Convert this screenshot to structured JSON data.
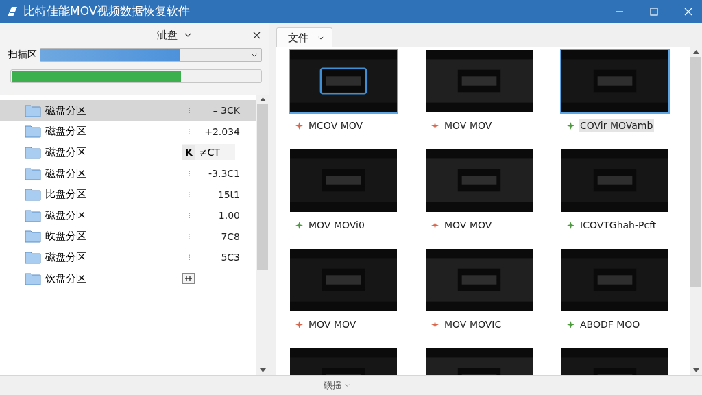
{
  "window": {
    "title": "比特佳能MOV视频数据恢复软件"
  },
  "left_panel": {
    "header": "泚盘",
    "scan": {
      "label": "扫描区",
      "level": 0.63
    },
    "progress": {
      "level": 0.68
    },
    "items": [
      {
        "name": "磁盘分区",
        "marker": "⁝",
        "value": "–  3CK",
        "selected": true,
        "kind": "dots"
      },
      {
        "name": "磁盘分区",
        "marker": "⁝",
        "value": "+2.034",
        "selected": false,
        "kind": "dots"
      },
      {
        "name": "磁盘分区",
        "marker": "K",
        "value": "≠CT",
        "selected": false,
        "kind": "key"
      },
      {
        "name": "磁盘分区",
        "marker": "⁝",
        "value": "-3.3C1",
        "selected": false,
        "kind": "dots"
      },
      {
        "name": "比盘分区",
        "marker": "⁝",
        "value": "15t1",
        "selected": false,
        "kind": "dots"
      },
      {
        "name": "磁盘分区",
        "marker": "⁝",
        "value": "1.00",
        "selected": false,
        "kind": "dots"
      },
      {
        "name": "敀盘分区",
        "marker": "⁝",
        "value": "7C8",
        "selected": false,
        "kind": "dots"
      },
      {
        "name": "磁盘分区",
        "marker": "⁝",
        "value": "5C3",
        "selected": false,
        "kind": "dots"
      },
      {
        "name": "饮盘分区",
        "kind": "box",
        "selected": false
      }
    ]
  },
  "right_panel": {
    "tab": "文件",
    "files": [
      {
        "kind": "captioned",
        "label": "ⅯCOV MOV",
        "color": "#d9664a",
        "selected": true,
        "highlighted": false
      },
      {
        "kind": "captioned",
        "label": "MOV MOV",
        "color": "#d9664a",
        "selected": false,
        "highlighted": false
      },
      {
        "kind": "captioned",
        "label": "COVir MOVamb",
        "color": "#4e9a3e",
        "selected": true,
        "highlighted": true
      },
      {
        "kind": "captioned",
        "label": "MOV MOVi0",
        "color": "#4e9a3e",
        "selected": false,
        "highlighted": false
      },
      {
        "kind": "captioned",
        "label": "MOV MOV",
        "color": "#d9664a",
        "selected": false,
        "highlighted": false
      },
      {
        "kind": "captioned",
        "label": "ICOVTGhah-Pcft",
        "color": "#4e9a3e",
        "selected": false,
        "highlighted": false
      },
      {
        "kind": "captioned",
        "label": "MOV MOV",
        "color": "#d9664a",
        "selected": false,
        "highlighted": false
      },
      {
        "kind": "captioned",
        "label": "MOV MOVIC",
        "color": "#d9664a",
        "selected": false,
        "highlighted": false
      },
      {
        "kind": "captioned",
        "label": "ABODF MOO",
        "color": "#4e9a3e",
        "selected": false,
        "highlighted": false
      },
      {
        "kind": "picture",
        "selected": false
      },
      {
        "kind": "picture",
        "selected": false
      },
      {
        "kind": "picture",
        "selected": false
      }
    ]
  },
  "status_bar": {
    "label": "磺揺"
  }
}
